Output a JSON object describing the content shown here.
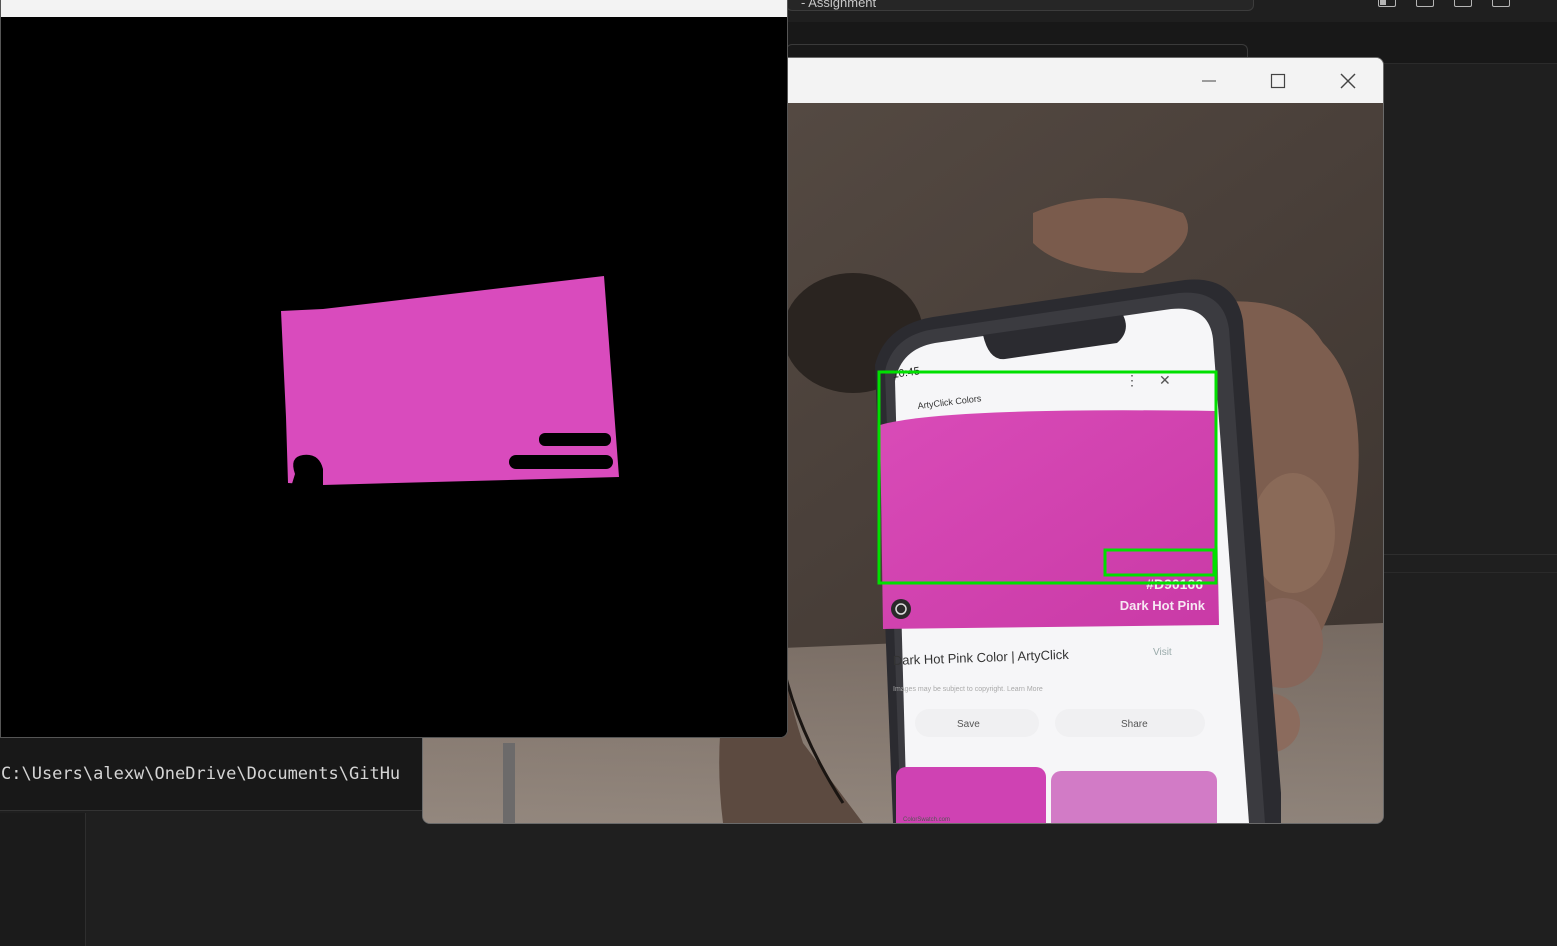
{
  "editor": {
    "command_center_text": "- Assignment",
    "layout_buttons": [
      "toggle-primary-sidebar-icon",
      "toggle-panel-icon",
      "toggle-secondary-sidebar-icon",
      "customize-layout-icon"
    ]
  },
  "terminal": {
    "path_line": "C:\\Users\\alexw\\OneDrive\\Documents\\GitHu"
  },
  "camera_window": {
    "controls": [
      "minimize-icon",
      "maximize-icon",
      "close-icon"
    ],
    "detection_box_color": "#00e000",
    "phone_screen": {
      "time": "10:45",
      "source": "ArtyClick Colors",
      "hex_code": "#D90166",
      "color_name": "Dark Hot Pink",
      "result_title": "Dark Hot Pink Color | ArtyClick",
      "visit_label": "Visit",
      "copyright_note": "Images may be subject to copyright. Learn More",
      "save_label": "Save",
      "share_label": "Share",
      "footer_source": "ColorSwatch.com",
      "swatch_color": "#d645b6"
    }
  },
  "mask_window": {
    "mask_color": "#d94bbd",
    "background_color": "#000000"
  }
}
